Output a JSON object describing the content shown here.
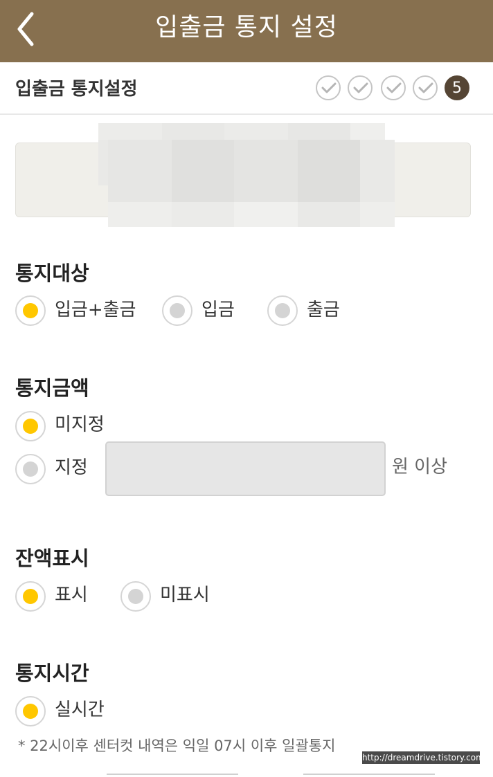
{
  "header": {
    "title": "입출금 통지 설정"
  },
  "subheader": {
    "title": "입출금 통지설정",
    "steps": {
      "completed": 4,
      "current": "5"
    }
  },
  "notify_target": {
    "title": "통지대상",
    "options": [
      {
        "label": "입금+출금",
        "selected": true
      },
      {
        "label": "입금",
        "selected": false
      },
      {
        "label": "출금",
        "selected": false
      }
    ]
  },
  "notify_amount": {
    "title": "통지금액",
    "options": [
      {
        "label": "미지정",
        "selected": true
      },
      {
        "label": "지정",
        "selected": false
      }
    ],
    "amount_value": "",
    "unit_label": "원 이상"
  },
  "balance_display": {
    "title": "잔액표시",
    "options": [
      {
        "label": "표시",
        "selected": true
      },
      {
        "label": "미표시",
        "selected": false
      }
    ]
  },
  "notify_time": {
    "title": "통지시간",
    "options": [
      {
        "label": "실시간",
        "selected": true
      }
    ],
    "note": "* 22시이후 센터컷 내역은 익일 07시 이후 일괄통지"
  },
  "watermark": "http://dreamdrive.tistory.com",
  "colors": {
    "header_bg": "#87704f",
    "selected_radio": "#ffc700",
    "unselected_radio": "#d4d4d4",
    "current_step": "#554534"
  }
}
